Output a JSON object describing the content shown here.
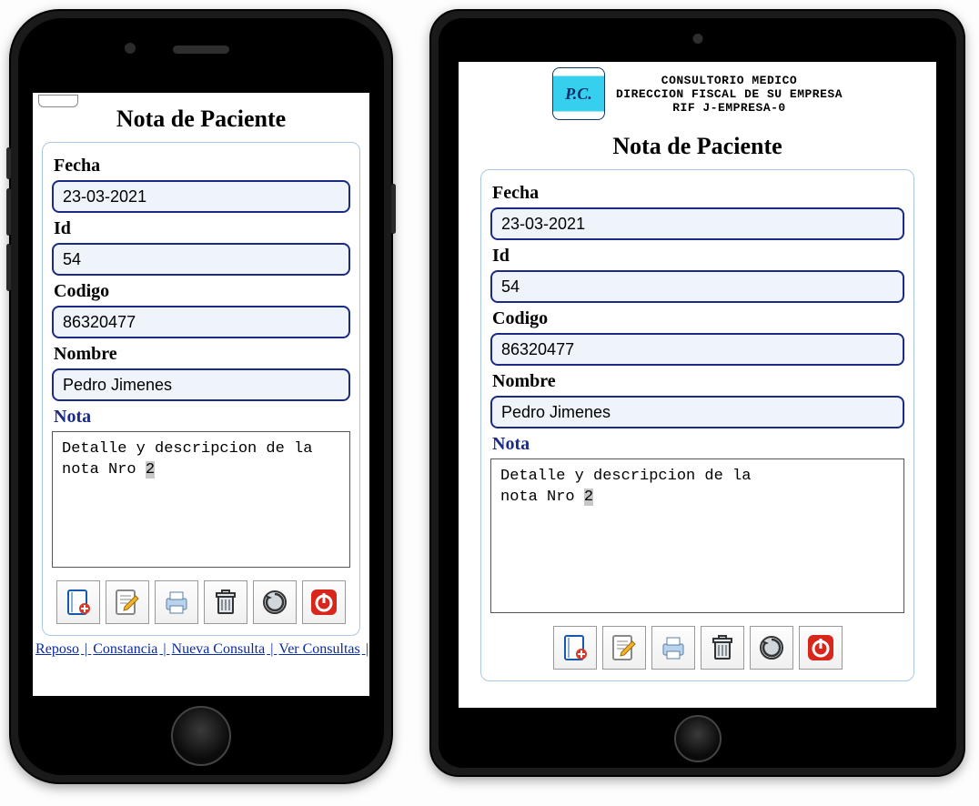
{
  "header": {
    "line1": "CONSULTORIO MEDICO",
    "line2": "DIRECCION FISCAL DE SU EMPRESA",
    "line3": "RIF J-EMPRESA-0",
    "logo_text": "P.C."
  },
  "title": "Nota de Paciente",
  "labels": {
    "fecha": "Fecha",
    "id": "Id",
    "codigo": "Codigo",
    "nombre": "Nombre",
    "nota": "Nota"
  },
  "values": {
    "fecha": "23-03-2021",
    "id": "54",
    "codigo": "86320477",
    "nombre": "Pedro Jimenes",
    "nota_line1": "Detalle y descripcion de la",
    "nota_line2_a": "nota Nro ",
    "nota_line2_sel": "2"
  },
  "toolbar": {
    "new": "new-note-icon",
    "edit": "edit-note-icon",
    "print": "print-icon",
    "delete": "trash-icon",
    "refresh": "refresh-icon",
    "power": "power-icon"
  },
  "links": {
    "reposo": "Reposo",
    "constancia": "Constancia",
    "nueva_consulta": "Nueva Consulta",
    "ver_consultas": "Ver Consultas"
  }
}
